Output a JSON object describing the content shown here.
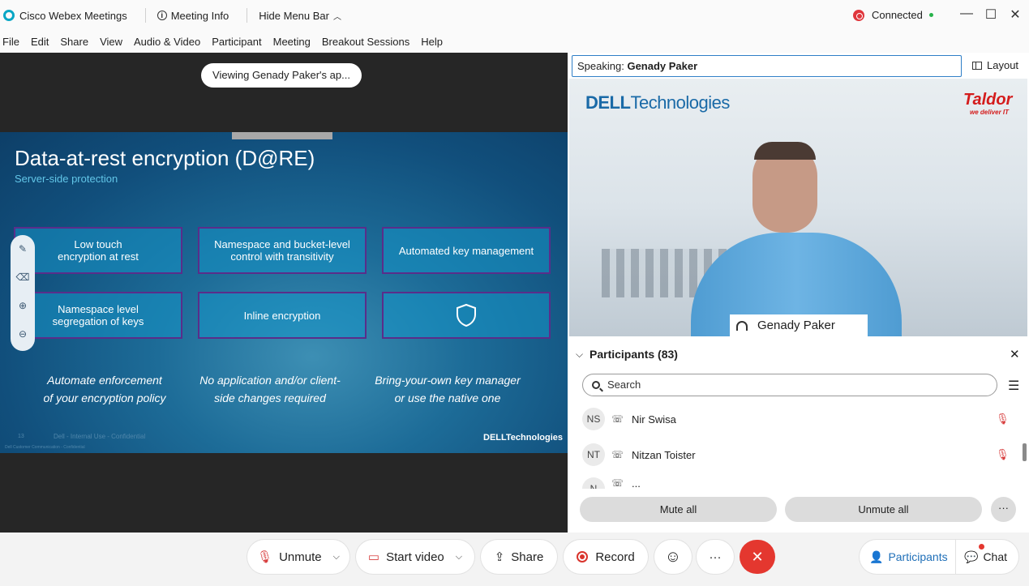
{
  "titlebar": {
    "app_name": "Cisco Webex Meetings",
    "meeting_info": "Meeting Info",
    "hide_menu_bar": "Hide Menu Bar",
    "connection_status": "Connected",
    "minimize": "—",
    "maximize": "☐",
    "close": "✕"
  },
  "menu": {
    "items": [
      "File",
      "Edit",
      "Share",
      "View",
      "Audio & Video",
      "Participant",
      "Meeting",
      "Breakout Sessions",
      "Help"
    ]
  },
  "share": {
    "viewing_pill": "Viewing Genady Paker's ap...",
    "slide": {
      "title": "Data-at-rest encryption (D@RE)",
      "subtitle": "Server-side protection",
      "boxes": [
        "Low touch\nencryption at rest",
        "Namespace and bucket-level\ncontrol with transitivity",
        "Automated key management",
        "Namespace level\nsegregation of keys",
        "Inline encryption"
      ],
      "captions": [
        "Automate enforcement\nof your encryption policy",
        "No application and/or client-\nside changes required",
        "Bring-your-own key manager\nor use the native one"
      ],
      "footer": "Dell - Internal Use - Confidential",
      "footer_small": "Dell Customer Communication - Confidential",
      "slide_number": "13",
      "dell_logo": "DELLTechnologies"
    }
  },
  "video": {
    "speaking_label": "Speaking:",
    "speaking_name": "Genady Paker",
    "layout_button": "Layout",
    "dell_logo_a": "DELL",
    "dell_logo_b": "Technologies",
    "taldor": "Taldor",
    "taldor_tagline": "we deliver IT",
    "name_tag": "Genady Paker"
  },
  "participants": {
    "title": "Participants (83)",
    "search_placeholder": "Search",
    "list": [
      {
        "initials": "NS",
        "name": "Nir Swisa"
      },
      {
        "initials": "NT",
        "name": "Nitzan Toister"
      },
      {
        "initials": "N",
        "name": "..."
      }
    ],
    "mute_all": "Mute all",
    "unmute_all": "Unmute all",
    "more": "···"
  },
  "controls": {
    "unmute": "Unmute",
    "start_video": "Start video",
    "share": "Share",
    "record": "Record",
    "more": "···",
    "participants": "Participants",
    "chat": "Chat"
  },
  "colors": {
    "accent": "#1f6fb8",
    "end_call": "#e4372f",
    "slide_bg": "#1d6c98",
    "slide_box_border": "#5a2d8a"
  }
}
